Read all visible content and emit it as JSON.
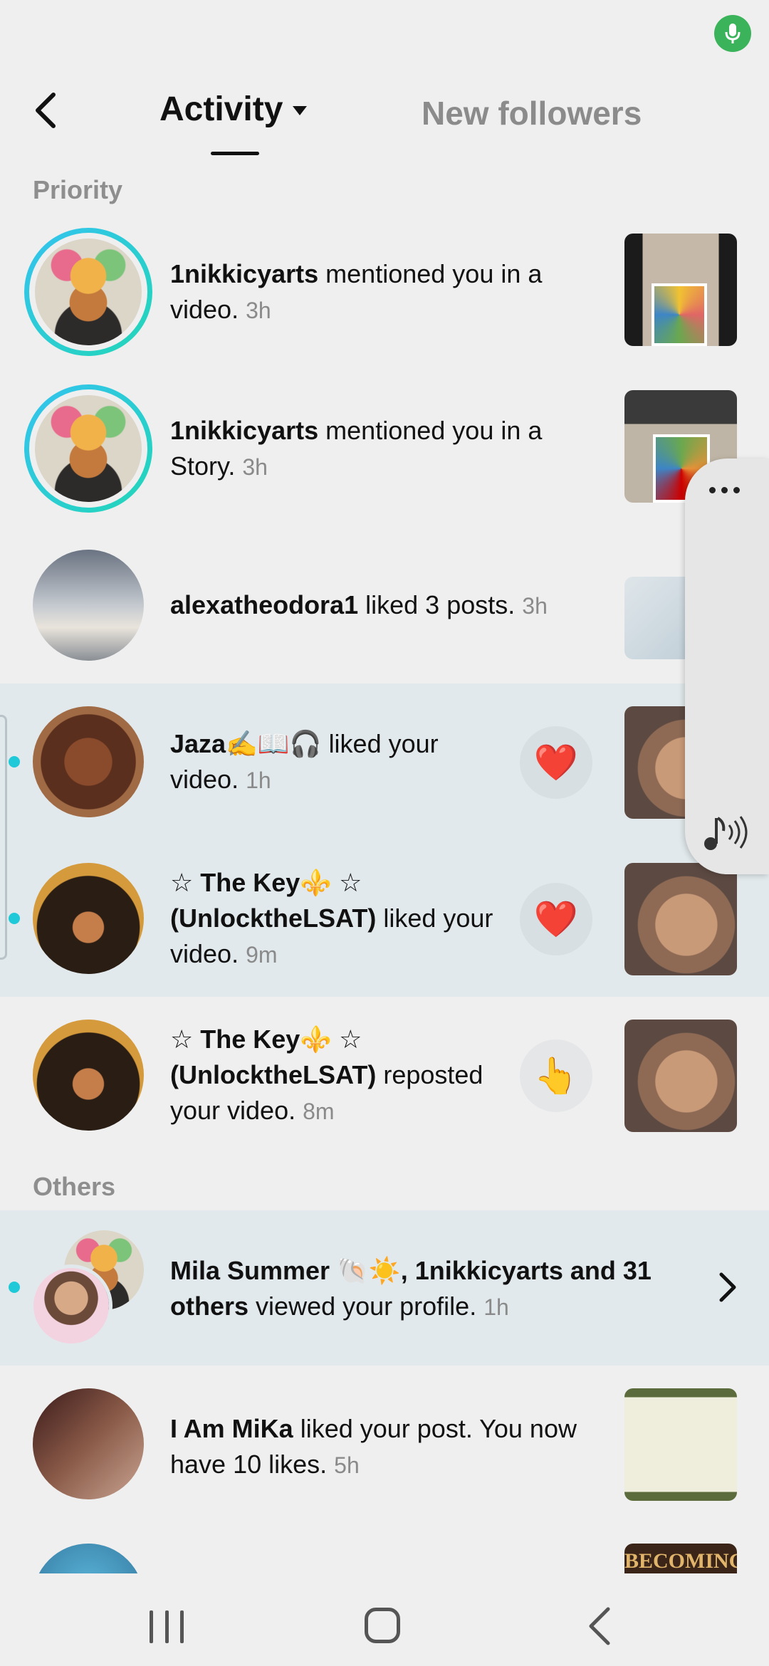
{
  "header": {
    "tab_activity": "Activity",
    "tab_new_followers": "New followers"
  },
  "sections": {
    "priority": "Priority",
    "others": "Others"
  },
  "notifications": [
    {
      "user": "1nikkicyarts",
      "text": "mentioned you in a video.",
      "time": "3h"
    },
    {
      "user": "1nikkicyarts",
      "text": "mentioned you in a Story.",
      "time": "3h"
    },
    {
      "user": "alexatheodora1",
      "text": "liked 3 posts.",
      "time": "3h"
    },
    {
      "user": "Jaza✍️📖🎧",
      "text": "liked your video.",
      "time": "1h",
      "reaction": "❤️"
    },
    {
      "user": "☆ The Key⚜️ ☆ (UnlocktheLSAT)",
      "text": "liked your video.",
      "time": "9m",
      "reaction": "❤️"
    },
    {
      "user": "☆ The Key⚜️ ☆ (UnlocktheLSAT)",
      "text": "reposted your video.",
      "time": "8m",
      "reaction": "👆"
    },
    {
      "user": "Mila Summer 🐚☀️, 1nikkicyarts and 31 others",
      "text": "viewed your profile.",
      "time": "1h"
    },
    {
      "user": "I Am MiKa",
      "text": "liked your post. You now have 10 likes.",
      "time": "5h"
    }
  ],
  "thumb_text": {
    "becoming": "BECOMING"
  },
  "icons": {
    "mic": "mic-icon",
    "back": "back-arrow-icon",
    "caret": "caret-down-icon",
    "chevron": "chevron-right-icon",
    "more": "more-dots-icon",
    "audio": "audio-icon"
  },
  "colors": {
    "background": "#efefef",
    "highlight": "#e1e9ec",
    "ring": "#22d6b7",
    "unread": "#20c9d8",
    "mic": "#3bb35a"
  }
}
